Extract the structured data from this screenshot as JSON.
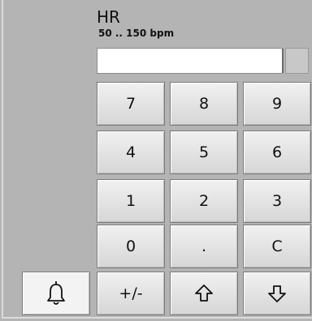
{
  "field": {
    "title": "HR",
    "range": "50 .. 150 bpm",
    "value": ""
  },
  "keypad": {
    "rows": [
      [
        "7",
        "8",
        "9"
      ],
      [
        "4",
        "5",
        "6"
      ],
      [
        "1",
        "2",
        "3"
      ],
      [
        "0",
        ".",
        "C"
      ]
    ],
    "sign_label": "+/-"
  },
  "icons": {
    "alarm": "bell-icon",
    "up": "arrow-up-icon",
    "down": "arrow-down-icon"
  }
}
